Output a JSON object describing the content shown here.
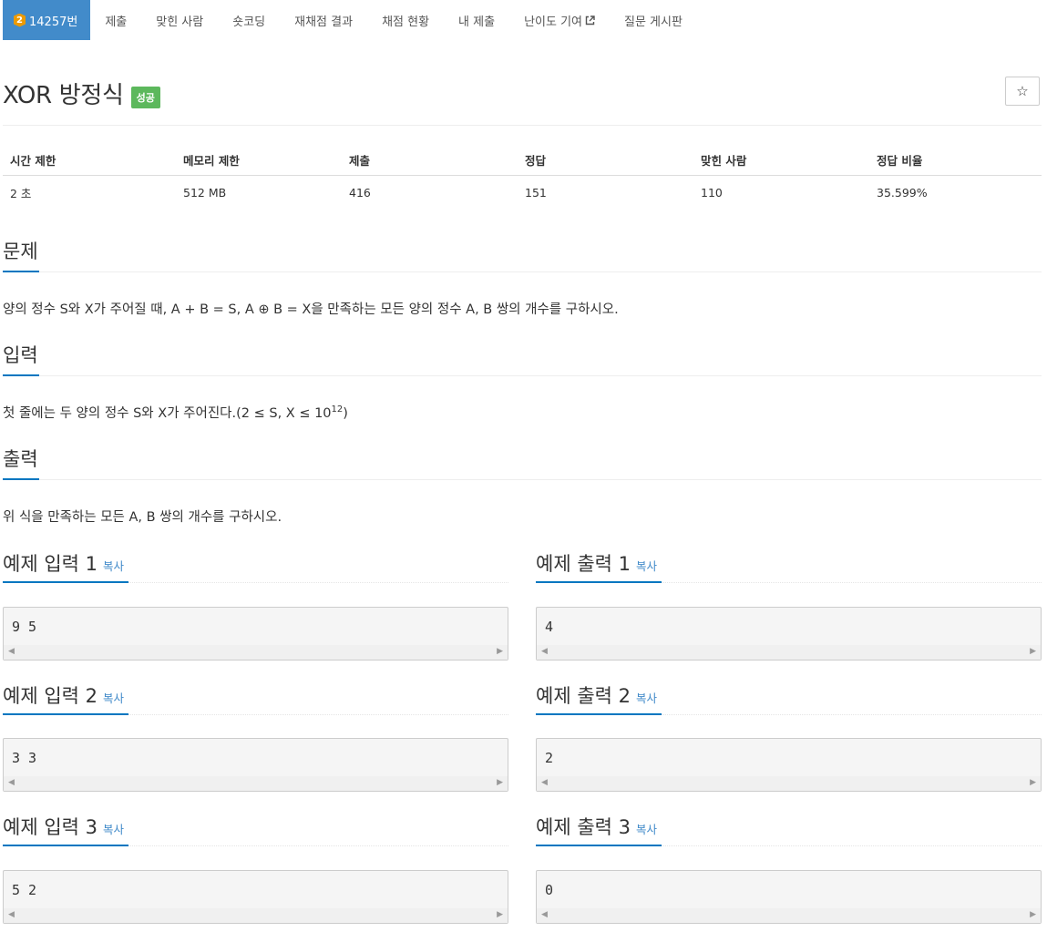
{
  "nav": {
    "tier": "2",
    "problem_tab": "14257번",
    "tabs": [
      "제출",
      "맞힌 사람",
      "숏코딩",
      "재채점 결과",
      "채점 현황",
      "내 제출",
      "난이도 기여",
      "질문 게시판"
    ]
  },
  "problem": {
    "title": "XOR 방정식",
    "badge": "성공",
    "star_icon": "☆"
  },
  "stats": {
    "headers": [
      "시간 제한",
      "메모리 제한",
      "제출",
      "정답",
      "맞힌 사람",
      "정답 비율"
    ],
    "values": [
      "2 초",
      "512 MB",
      "416",
      "151",
      "110",
      "35.599%"
    ]
  },
  "sections": {
    "problem_title": "문제",
    "problem_text": "양의 정수 S와 X가 주어질 때, A + B = S, A ⊕ B = X을 만족하는 모든 양의 정수 A, B 쌍의 개수를 구하시오.",
    "input_title": "입력",
    "input_text_before": "첫 줄에는 두 양의 정수 S와 X가 주어진다.(2 ≤ S, X ≤ 10",
    "input_text_sup": "12",
    "input_text_after": ")",
    "output_title": "출력",
    "output_text": "위 식을 만족하는 모든 A, B 쌍의 개수를 구하시오."
  },
  "samples": {
    "copy_label": "복사",
    "in1_title": "예제 입력 1",
    "in1_value": "9 5",
    "out1_title": "예제 출력 1",
    "out1_value": "4",
    "in2_title": "예제 입력 2",
    "in2_value": "3 3",
    "out2_title": "예제 출력 2",
    "out2_value": "2",
    "in3_title": "예제 입력 3",
    "in3_value": "5 2",
    "out3_title": "예제 출력 3",
    "out3_value": "0"
  },
  "colors": {
    "accent": "#428bca",
    "success": "#5cb85c",
    "tier_gold": "#ec9a00"
  }
}
